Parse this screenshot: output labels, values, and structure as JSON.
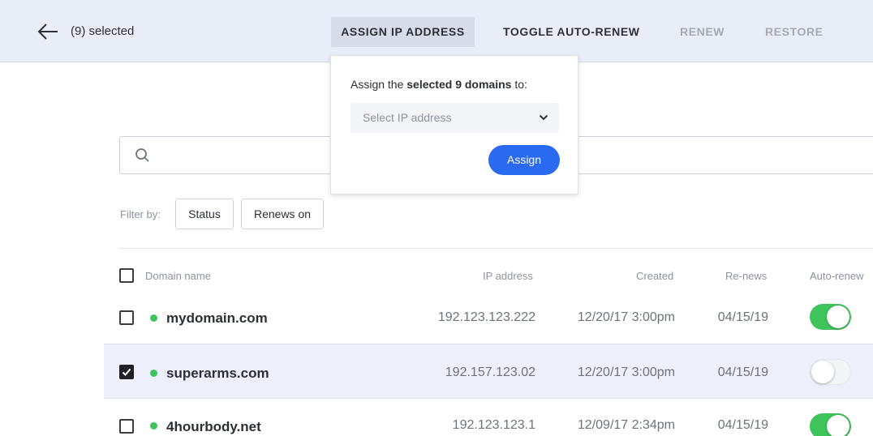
{
  "header": {
    "selected_label": "(9) selected",
    "actions": [
      {
        "label": "ASSIGN IP ADDRESS"
      },
      {
        "label": "TOGGLE AUTO-RENEW"
      },
      {
        "label": "RENEW"
      },
      {
        "label": "RESTORE"
      }
    ]
  },
  "popover": {
    "text_prefix": "Assign the",
    "text_bold": "selected 9 domains",
    "text_suffix": "to:",
    "select_placeholder": "Select IP address",
    "assign_label": "Assign"
  },
  "search": {
    "placeholder": ""
  },
  "filters": {
    "label": "Filter by:",
    "buttons": [
      {
        "label": "Status"
      },
      {
        "label": "Renews on"
      }
    ]
  },
  "table": {
    "columns": {
      "domain": "Domain name",
      "ip": "IP address",
      "created": "Created",
      "renews": "Re-news",
      "autorenew": "Auto-renew"
    },
    "rows": [
      {
        "domain": "mydomain.com",
        "ip": "192.123.123.222",
        "created": "12/20/17 3:00pm",
        "renews": "04/15/19",
        "checked": false,
        "auto_renew": true
      },
      {
        "domain": "superarms.com",
        "ip": "192.157.123.02",
        "created": "12/20/17 3:00pm",
        "renews": "04/15/19",
        "checked": true,
        "auto_renew": false
      },
      {
        "domain": "4hourbody.net",
        "ip": "192.123.123.1",
        "created": "12/09/17 2:34pm",
        "renews": "04/15/19",
        "checked": false,
        "auto_renew": true
      }
    ]
  },
  "colors": {
    "topbar": "#e9edf8",
    "primary": "#2a6af0",
    "status_dot": "#3fc45c",
    "toggle_on": "#3fc45c",
    "selected_row": "#edf0fa"
  },
  "icons": {
    "back": "arrow-left-icon",
    "search": "search-icon",
    "select": "chevron-down-icon",
    "check": "check-icon"
  }
}
